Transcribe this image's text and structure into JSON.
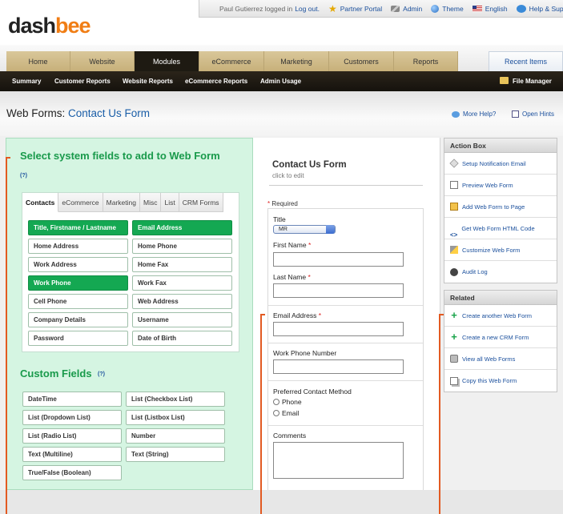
{
  "brand": {
    "logo_a": "dash",
    "logo_b": "bee"
  },
  "userbar": {
    "logged_text": "Paul Gutierrez logged in",
    "logout": "Log out.",
    "items": [
      {
        "label": "Partner Portal",
        "icon": "star-icon"
      },
      {
        "label": "Admin",
        "icon": "wrench-icon"
      },
      {
        "label": "Theme",
        "icon": "globe-icon"
      },
      {
        "label": "English",
        "icon": "flag-icon"
      },
      {
        "label": "Help & Support",
        "icon": "help-icon"
      }
    ]
  },
  "main_nav": {
    "tabs": [
      "Home",
      "Website",
      "Modules",
      "eCommerce",
      "Marketing",
      "Customers",
      "Reports"
    ],
    "active": "Modules",
    "recent": "Recent Items"
  },
  "sub_nav": {
    "items": [
      "Summary",
      "Customer Reports",
      "Website Reports",
      "eCommerce Reports",
      "Admin Usage"
    ],
    "file_manager": "File Manager"
  },
  "page": {
    "title_prefix": "Web Forms:",
    "title_link": "Contact Us Form",
    "more_help": "More Help?",
    "open_hints": "Open Hints"
  },
  "system_fields": {
    "heading": "Select system fields to add to Web Form",
    "help": "(?)",
    "tabs": [
      "Contacts",
      "eCommerce",
      "Marketing",
      "Misc",
      "List",
      "CRM Forms"
    ],
    "active_tab": "Contacts",
    "fields": [
      {
        "label": "Title, Firstname / Lastname",
        "selected": true
      },
      {
        "label": "Email Address",
        "selected": true
      },
      {
        "label": "Home Address",
        "selected": false
      },
      {
        "label": "Home Phone",
        "selected": false
      },
      {
        "label": "Work Address",
        "selected": false
      },
      {
        "label": "Home Fax",
        "selected": false
      },
      {
        "label": "Work Phone",
        "selected": true
      },
      {
        "label": "Work Fax",
        "selected": false
      },
      {
        "label": "Cell Phone",
        "selected": false
      },
      {
        "label": "Web Address",
        "selected": false
      },
      {
        "label": "Company Details",
        "selected": false
      },
      {
        "label": "Username",
        "selected": false
      },
      {
        "label": "Password",
        "selected": false
      },
      {
        "label": "Date of Birth",
        "selected": false
      }
    ]
  },
  "custom_fields": {
    "heading": "Custom Fields",
    "help": "(?)",
    "fields": [
      "DateTime",
      "List (Checkbox List)",
      "List (Dropdown List)",
      "List (Listbox List)",
      "List (Radio List)",
      "Number",
      "Text (Multiline)",
      "Text (String)",
      "True/False (Boolean)"
    ]
  },
  "form": {
    "title": "Contact Us Form",
    "subtitle": "click to edit",
    "required_mark": "*",
    "required_text": " Required",
    "title_label": "Title",
    "title_value": "MR",
    "first_name": "First Name",
    "last_name": "Last Name",
    "email": "Email Address",
    "work_phone": "Work Phone Number",
    "contact_method": "Preferred Contact Method",
    "options": [
      "Phone",
      "Email"
    ],
    "comments": "Comments",
    "star": "*"
  },
  "action_box": {
    "heading": "Action Box",
    "items": [
      {
        "label": "Setup Notification Email",
        "icon": "tag-icon"
      },
      {
        "label": "Preview Web Form",
        "icon": "document-icon"
      },
      {
        "label": "Add Web Form to Page",
        "icon": "mail-icon"
      },
      {
        "label": "Get Web Form HTML Code",
        "icon": "code-icon",
        "glyph": "<>"
      },
      {
        "label": "Customize Web Form",
        "icon": "tools-icon"
      },
      {
        "label": "Audit Log",
        "icon": "audit-icon"
      }
    ]
  },
  "related": {
    "heading": "Related",
    "items": [
      {
        "label": "Create another Web Form",
        "icon": "plus-icon",
        "glyph": "+"
      },
      {
        "label": "Create a new CRM Form",
        "icon": "plus-icon",
        "glyph": "+"
      },
      {
        "label": "View all Web Forms",
        "icon": "view-icon"
      },
      {
        "label": "Copy this Web Form",
        "icon": "copy-icon"
      }
    ]
  },
  "colors": {
    "accent_green": "#14a852",
    "heading_green": "#199a4b",
    "link_blue": "#1a4f9c",
    "nav_dark": "#1e1a12",
    "marker_orange": "#e25a22"
  }
}
